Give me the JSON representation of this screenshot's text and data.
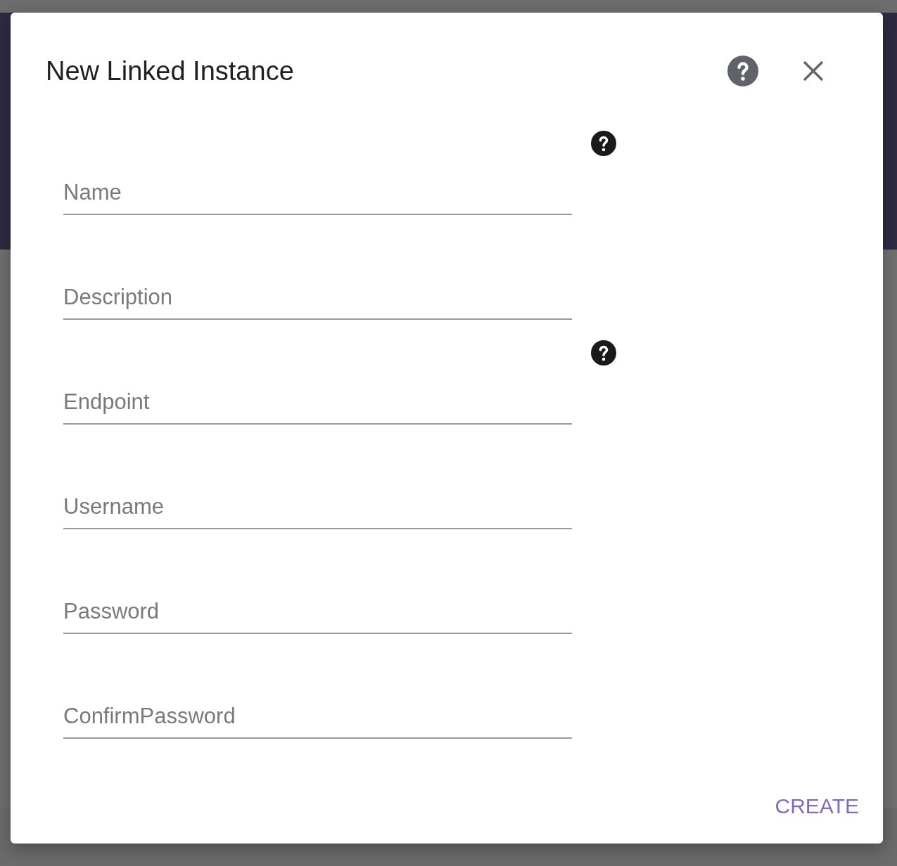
{
  "dialog": {
    "title": "New Linked Instance",
    "fields": [
      {
        "placeholder": "Name",
        "help": true
      },
      {
        "placeholder": "Description",
        "help": false
      },
      {
        "placeholder": "Endpoint",
        "help": true
      },
      {
        "placeholder": "Username",
        "help": false
      },
      {
        "placeholder": "Password",
        "help": false
      },
      {
        "placeholder": "ConfirmPassword",
        "help": false
      }
    ],
    "create_button": "CREATE"
  }
}
